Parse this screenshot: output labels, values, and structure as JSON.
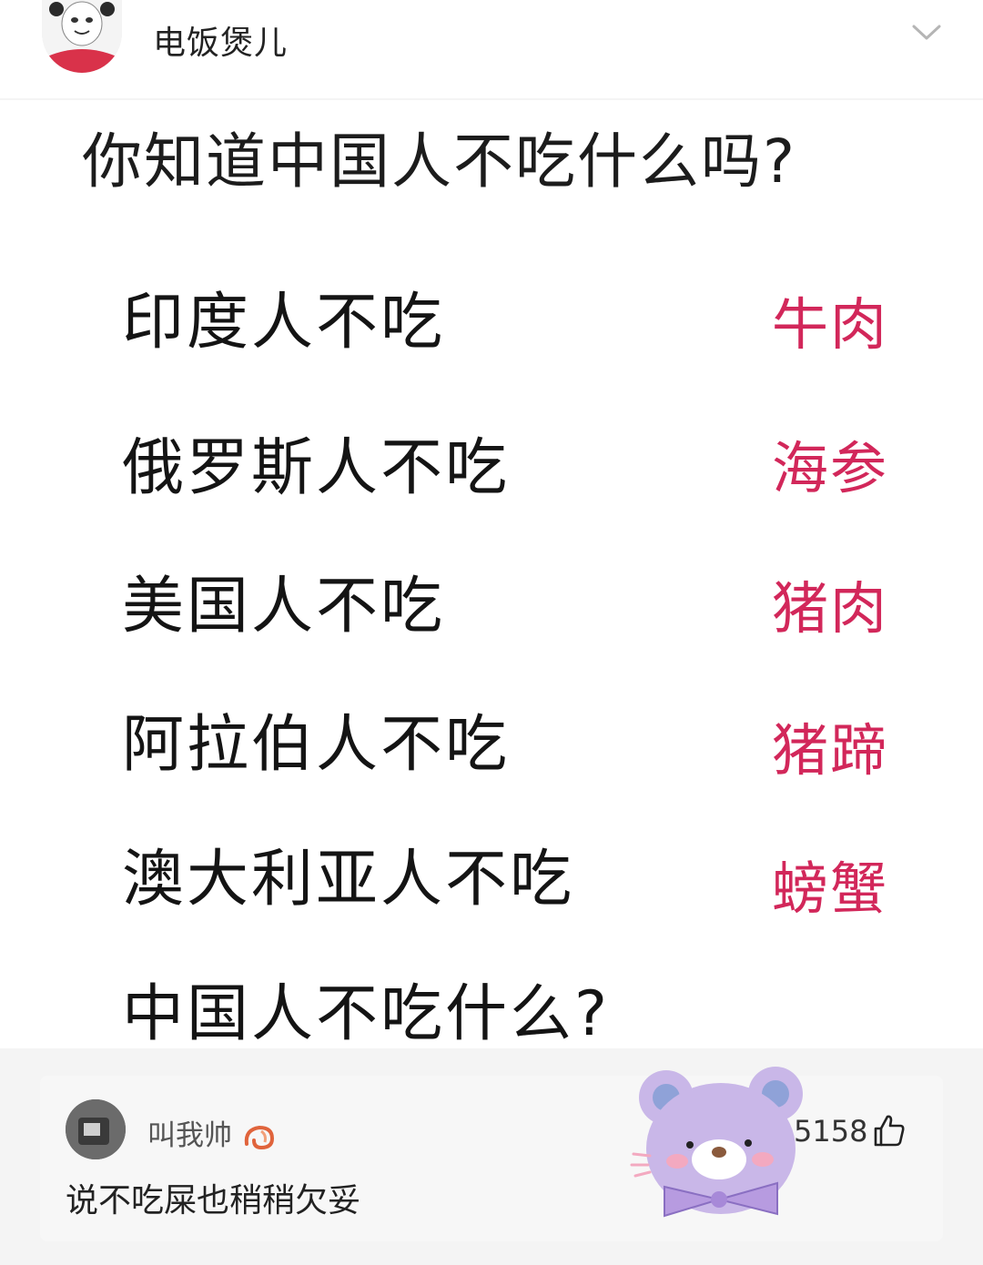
{
  "header": {
    "username": "电饭煲儿",
    "avatar_icon": "panda-meme-avatar-icon",
    "menu_icon": "chevron-down-icon"
  },
  "post_image": {
    "question": "你知道中国人不吃什么吗?",
    "rows": [
      {
        "left": "印度人不吃",
        "right": "牛肉"
      },
      {
        "left": "俄罗斯人不吃",
        "right": "海参"
      },
      {
        "left": "美国人不吃",
        "right": "猪肉"
      },
      {
        "left": "阿拉伯人不吃",
        "right": "猪蹄"
      },
      {
        "left": "澳大利亚人不吃",
        "right": "螃蟹"
      },
      {
        "left": "中国人不吃什么?",
        "right": ""
      }
    ],
    "answer_color": "#d2275a"
  },
  "comment": {
    "author": "叫我帅",
    "author_badge_icon": "shrimp-icon",
    "text": "说不吃屎也稍稍欠妥",
    "likes": "5158",
    "like_icon": "thumbs-up-icon",
    "sticker_icon": "purple-bear-sticker-icon"
  }
}
